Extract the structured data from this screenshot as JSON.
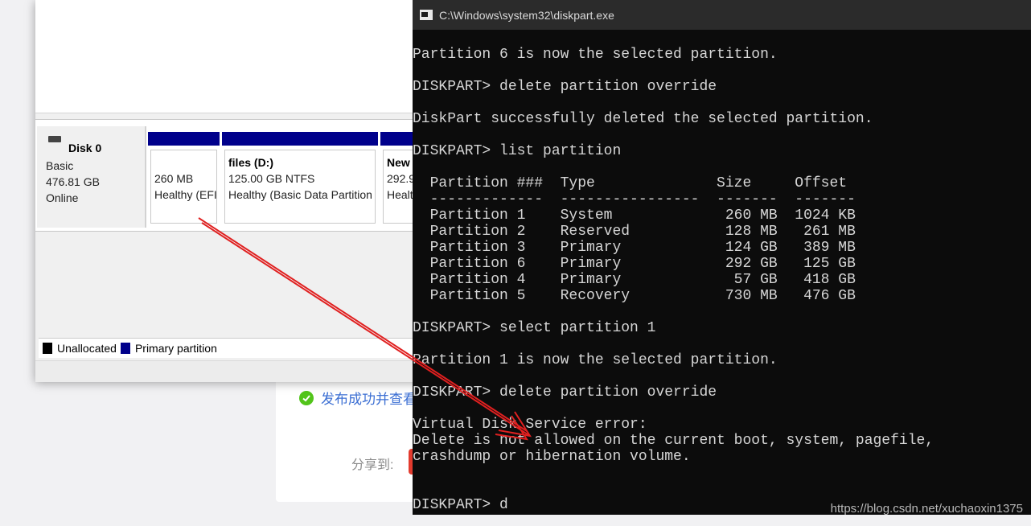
{
  "background_page": {
    "publish_text": "发布成功并查看",
    "share_label": "分享到:"
  },
  "disk_management": {
    "disk": {
      "title": "Disk 0",
      "type": "Basic",
      "size": "476.81 GB",
      "status": "Online"
    },
    "partitions": [
      {
        "name": "",
        "size_line": "260 MB",
        "status_line": "Healthy (EFI"
      },
      {
        "name": "files  (D:)",
        "size_line": "125.00 GB NTFS",
        "status_line": "Healthy (Basic Data Partition"
      },
      {
        "name": "New",
        "size_line": "292.9",
        "status_line": "Healt"
      }
    ],
    "legend": [
      {
        "label": "Unallocated",
        "color": "#000000"
      },
      {
        "label": "Primary partition",
        "color": "#00008b"
      }
    ]
  },
  "console": {
    "title": "C:\\Windows\\system32\\diskpart.exe",
    "lines": [
      "Partition 6 is now the selected partition.",
      "",
      "DISKPART> delete partition override",
      "",
      "DiskPart successfully deleted the selected partition.",
      "",
      "DISKPART> list partition",
      "",
      "  Partition ###  Type              Size     Offset",
      "  -------------  ----------------  -------  -------",
      "  Partition 1    System             260 MB  1024 KB",
      "  Partition 2    Reserved           128 MB   261 MB",
      "  Partition 3    Primary            124 GB   389 MB",
      "  Partition 6    Primary            292 GB   125 GB",
      "  Partition 4    Primary             57 GB   418 GB",
      "  Partition 5    Recovery           730 MB   476 GB",
      "",
      "DISKPART> select partition 1",
      "",
      "Partition 1 is now the selected partition.",
      "",
      "DISKPART> delete partition override",
      "",
      "Virtual Disk Service error:",
      "Delete is not allowed on the current boot, system, pagefile,",
      "crashdump or hibernation volume.",
      "",
      "",
      "DISKPART> d"
    ]
  },
  "watermark": "https://blog.csdn.net/xuchaoxin1375",
  "colors": {
    "annotation_arrow": "#e02020",
    "primary_partition": "#00008b",
    "console_bg": "#0c0c0c"
  }
}
